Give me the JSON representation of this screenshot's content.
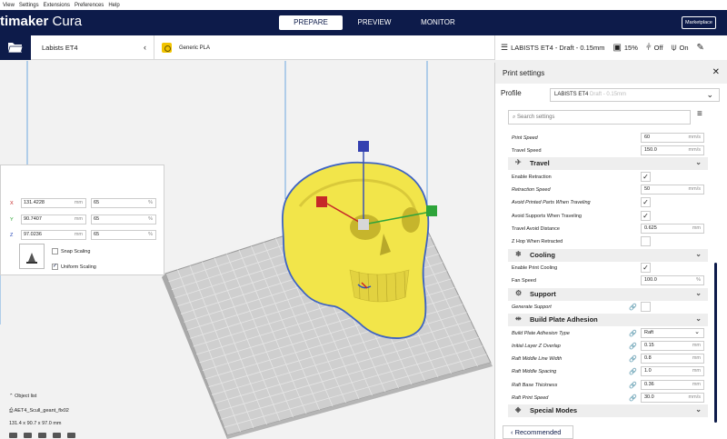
{
  "menubar": [
    "View",
    "Settings",
    "Extensions",
    "Preferences",
    "Help"
  ],
  "app": {
    "title_part1": "timaker",
    "title_part2": "Cura",
    "marketplace": "Marketplace"
  },
  "stages": [
    "PREPARE",
    "PREVIEW",
    "MONITOR"
  ],
  "toolbar": {
    "machine": "Labists ET4",
    "material": "Generic PLA",
    "print_setting": "LABISTS ET4 - Draft - 0.15mm",
    "infill": "15%",
    "support": "Off",
    "adhesion": "On"
  },
  "scale": {
    "x_mm": "131.4228",
    "x_pct": "65",
    "y_mm": "90.7407",
    "y_pct": "65",
    "z_mm": "97.0236",
    "z_pct": "65",
    "unit_mm": "mm",
    "unit_pct": "%",
    "axis_x": "X",
    "axis_y": "Y",
    "axis_z": "Z",
    "snap": "Snap Scaling",
    "uniform": "Uniform Scaling"
  },
  "objects": {
    "title": "Object list",
    "file": "AET4_Scull_geant_flx02",
    "dims": "131.4 x 90.7 x 97.0 mm"
  },
  "settings": {
    "title": "Print settings",
    "profile_label": "Profile",
    "profile_value": "LABISTS ET4",
    "profile_suffix": "Draft - 0.15mm",
    "search_placeholder": "Search settings",
    "recommended": "Recommended",
    "rows": [
      {
        "label": "Print Speed",
        "value": "60",
        "unit": "mm/s",
        "kind": "val",
        "italic": true
      },
      {
        "label": "Travel Speed",
        "value": "150.0",
        "unit": "mm/s",
        "kind": "val"
      },
      {
        "label": "Enable Retraction",
        "kind": "chk",
        "checked": true
      },
      {
        "label": "Retraction Speed",
        "value": "50",
        "unit": "mm/s",
        "kind": "val",
        "italic": true
      },
      {
        "label": "Avoid Printed Parts When Traveling",
        "kind": "chk",
        "checked": true,
        "italic": true
      },
      {
        "label": "Avoid Supports When Traveling",
        "kind": "chk",
        "checked": true
      },
      {
        "label": "Travel Avoid Distance",
        "value": "0.625",
        "unit": "mm",
        "kind": "val"
      },
      {
        "label": "Z Hop When Retracted",
        "kind": "chk",
        "checked": false
      },
      {
        "label": "Enable Print Cooling",
        "kind": "chk",
        "checked": true
      },
      {
        "label": "Fan Speed",
        "value": "100.0",
        "unit": "%",
        "kind": "val"
      },
      {
        "label": "Generate Support",
        "kind": "chk",
        "checked": false,
        "italic": true,
        "link": true
      },
      {
        "label": "Build Plate Adhesion Type",
        "value": "Raft",
        "kind": "sel",
        "italic": true,
        "link": true
      },
      {
        "label": "Initial Layer Z Overlap",
        "value": "0.15",
        "unit": "mm",
        "kind": "val",
        "italic": true,
        "link": true
      },
      {
        "label": "Raft Middle Line Width",
        "value": "0.8",
        "unit": "mm",
        "kind": "val",
        "italic": true,
        "link": true
      },
      {
        "label": "Raft Middle Spacing",
        "value": "1.0",
        "unit": "mm",
        "kind": "val",
        "italic": true,
        "link": true
      },
      {
        "label": "Raft Base Thickness",
        "value": "0.36",
        "unit": "mm",
        "kind": "val",
        "italic": true,
        "link": true
      },
      {
        "label": "Raft Print Speed",
        "value": "30.0",
        "unit": "mm/s",
        "kind": "val",
        "italic": true,
        "link": true
      }
    ],
    "categories": [
      "Travel",
      "Cooling",
      "Support",
      "Build Plate Adhesion",
      "Special Modes"
    ]
  }
}
